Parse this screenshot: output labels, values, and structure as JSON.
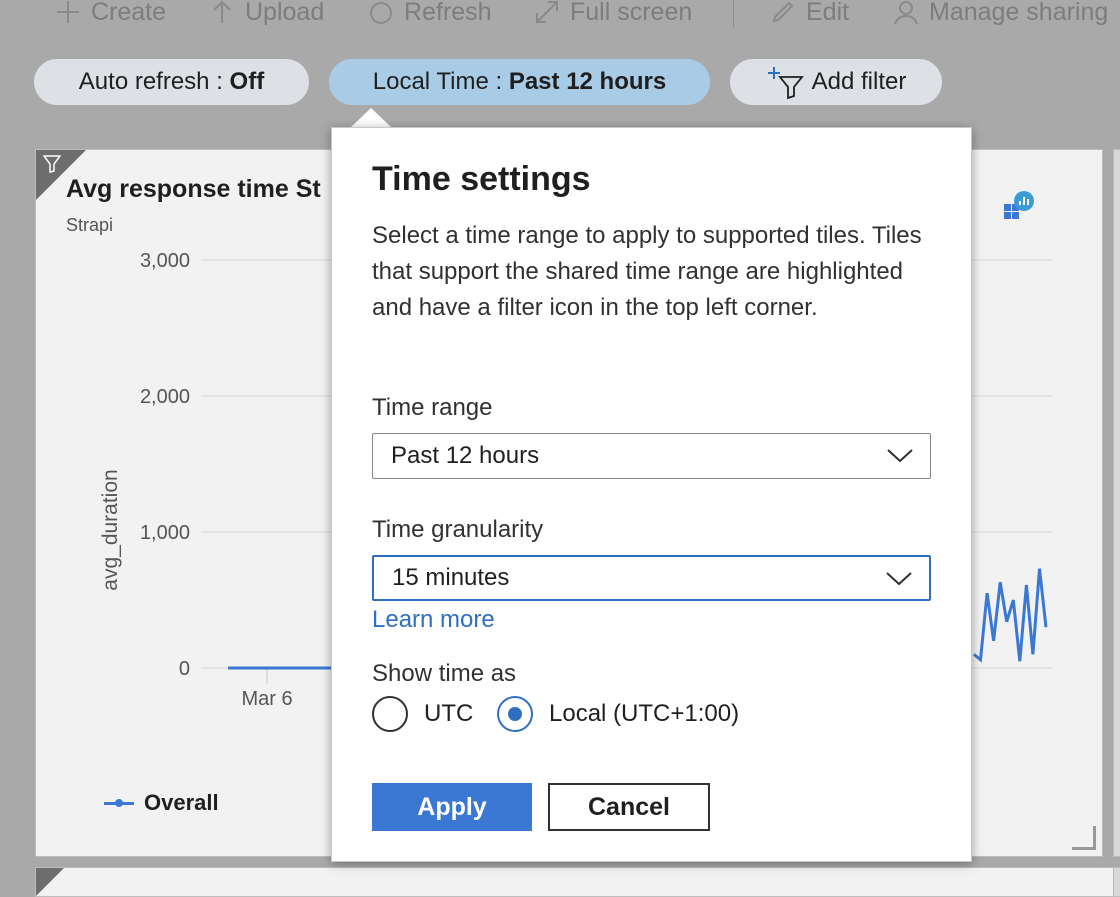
{
  "toolbar": {
    "items": [
      {
        "label": "Create",
        "icon": "plus-icon"
      },
      {
        "label": "Upload",
        "icon": "upload-arrow-icon"
      },
      {
        "label": "Refresh",
        "icon": "refresh-icon"
      },
      {
        "label": "Full screen",
        "icon": "full-screen-icon"
      },
      {
        "label": "Edit",
        "icon": "pencil-icon"
      },
      {
        "label": "Manage sharing",
        "icon": "people-icon"
      }
    ]
  },
  "filters": {
    "auto_refresh_label": "Auto refresh",
    "auto_refresh_value": "Off",
    "time_label": "Local Time",
    "time_value": "Past 12 hours",
    "add_filter_label": "Add filter",
    "separator": " : "
  },
  "tile": {
    "title": "Avg response time St",
    "subtitle": "Strapi"
  },
  "chart_data": {
    "type": "line",
    "title": "Avg response time St",
    "subtitle": "Strapi",
    "ylabel": "avg_duration",
    "xlabel": "",
    "yticks": [
      "3,000",
      "2,000",
      "1,000",
      "0"
    ],
    "ylim": [
      0,
      3000
    ],
    "xticks": [
      "Mar 6"
    ],
    "grid": true,
    "legend_position": "bottom-left",
    "series": [
      {
        "name": "Overall",
        "color": "#3b78d4",
        "visible_segments": [
          {
            "values": [
              0,
              0,
              0,
              0
            ]
          },
          {
            "values": [
              100,
              60,
              550,
              200,
              630,
              340,
              500,
              50,
              610,
              100,
              730,
              300
            ]
          }
        ]
      }
    ]
  },
  "popup": {
    "title": "Time settings",
    "description": "Select a time range to apply to supported tiles. Tiles that support the shared time range are highlighted and have a filter icon in the top left corner.",
    "time_range_label": "Time range",
    "time_range_value": "Past 12 hours",
    "granularity_label": "Time granularity",
    "granularity_value": "15 minutes",
    "learn_more": "Learn more",
    "show_time_label": "Show time as",
    "utc_label": "UTC",
    "local_label": "Local (UTC+1:00)",
    "selected_timezone": "Local (UTC+1:00)",
    "apply_label": "Apply",
    "cancel_label": "Cancel"
  }
}
